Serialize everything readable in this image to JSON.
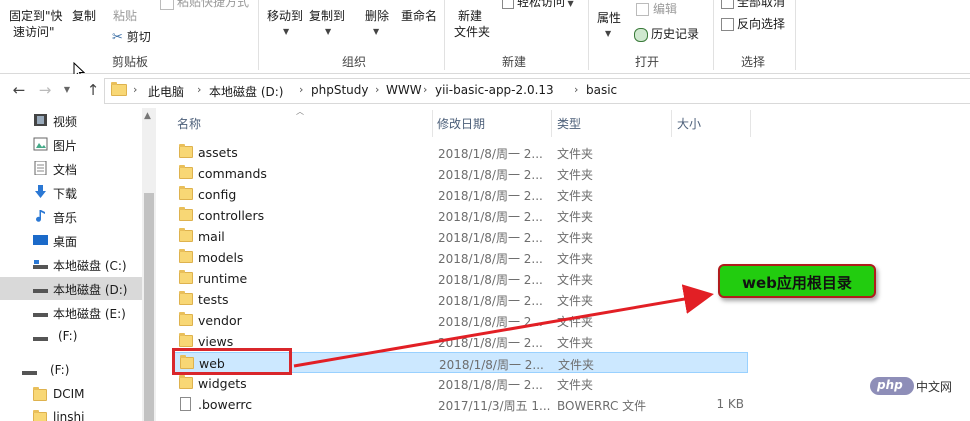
{
  "ribbon": {
    "clipboard": {
      "pin_label_line1": "固定到\"快",
      "pin_label_line2": "速访问\"",
      "copy_label": "复制",
      "paste_label": "粘贴",
      "paste_shortcut_label": "粘贴快捷方式",
      "cut_label": "剪切",
      "group_label": "剪贴板"
    },
    "organize": {
      "move_to_label": "移动到",
      "copy_to_label": "复制到",
      "delete_label": "删除",
      "rename_label": "重命名",
      "group_label": "组织"
    },
    "new": {
      "new_folder_line1": "新建",
      "new_folder_line2": "文件夹",
      "easy_access_label": "轻松访问",
      "group_label": "新建"
    },
    "open": {
      "properties_label": "属性",
      "edit_label": "编辑",
      "history_label": "历史记录",
      "group_label": "打开"
    },
    "select": {
      "select_all_label": "全部取消",
      "invert_label": "反向选择",
      "group_label": "选择"
    }
  },
  "address": {
    "crumbs": [
      "此电脑",
      "本地磁盘 (D:)",
      "phpStudy",
      "WWW",
      "yii-basic-app-2.0.13",
      "basic"
    ]
  },
  "navpane": {
    "items": [
      {
        "label": "视频",
        "icon": "video-icon"
      },
      {
        "label": "图片",
        "icon": "pictures-icon"
      },
      {
        "label": "文档",
        "icon": "documents-icon"
      },
      {
        "label": "下载",
        "icon": "downloads-icon"
      },
      {
        "label": "音乐",
        "icon": "music-icon"
      },
      {
        "label": "桌面",
        "icon": "desktop-icon"
      },
      {
        "label": "本地磁盘 (C:)",
        "icon": "drive-icon"
      },
      {
        "label": "本地磁盘 (D:)",
        "icon": "drive-icon"
      },
      {
        "label": "本地磁盘 (E:)",
        "icon": "drive-icon"
      },
      {
        "label": "(F:)",
        "icon": "drive-icon"
      },
      {
        "label": "(F:)",
        "icon": "drive-icon"
      },
      {
        "label": "DCIM",
        "icon": "folder-icon"
      },
      {
        "label": "linshi",
        "icon": "folder-icon"
      }
    ]
  },
  "columns": {
    "name": "名称",
    "modified": "修改日期",
    "type": "类型",
    "size": "大小"
  },
  "files": [
    {
      "name": "assets",
      "date": "2018/1/8/周一 2...",
      "type": "文件夹",
      "size": ""
    },
    {
      "name": "commands",
      "date": "2018/1/8/周一 2...",
      "type": "文件夹",
      "size": ""
    },
    {
      "name": "config",
      "date": "2018/1/8/周一 2...",
      "type": "文件夹",
      "size": ""
    },
    {
      "name": "controllers",
      "date": "2018/1/8/周一 2...",
      "type": "文件夹",
      "size": ""
    },
    {
      "name": "mail",
      "date": "2018/1/8/周一 2...",
      "type": "文件夹",
      "size": ""
    },
    {
      "name": "models",
      "date": "2018/1/8/周一 2...",
      "type": "文件夹",
      "size": ""
    },
    {
      "name": "runtime",
      "date": "2018/1/8/周一 2...",
      "type": "文件夹",
      "size": ""
    },
    {
      "name": "tests",
      "date": "2018/1/8/周一 2...",
      "type": "文件夹",
      "size": ""
    },
    {
      "name": "vendor",
      "date": "2018/1/8/周一 2...",
      "type": "文件夹",
      "size": ""
    },
    {
      "name": "views",
      "date": "2018/1/8/周一 2...",
      "type": "文件夹",
      "size": ""
    },
    {
      "name": "web",
      "date": "2018/1/8/周一 2...",
      "type": "文件夹",
      "size": ""
    },
    {
      "name": "widgets",
      "date": "2018/1/8/周一 2...",
      "type": "文件夹",
      "size": ""
    },
    {
      "name": ".bowerrc",
      "date": "2017/11/3/周五 1...",
      "type": "BOWERRC 文件",
      "size": "1 KB"
    }
  ],
  "annotation": {
    "callout_text": "web应用根目录",
    "callout_color": "#22cc0f",
    "highlight_color": "#d9262b"
  },
  "watermark": {
    "logo_text": "php",
    "site_text": "中文网"
  }
}
